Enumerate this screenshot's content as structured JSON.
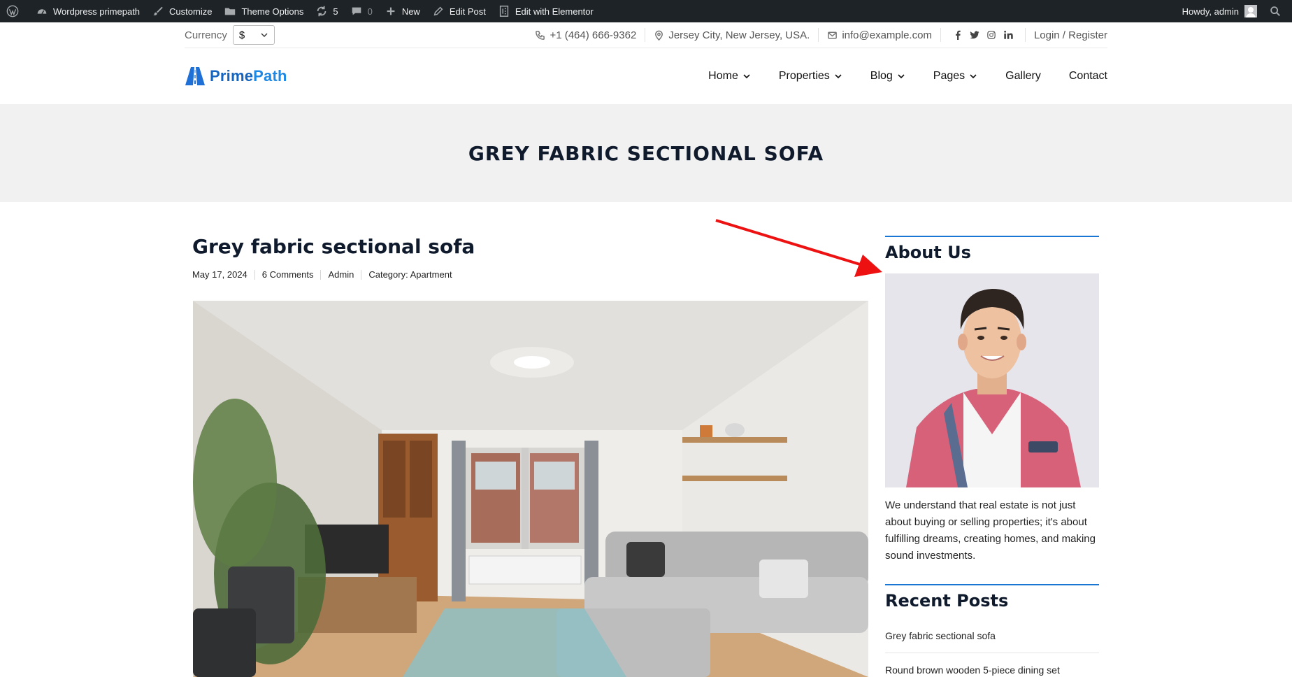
{
  "admin_bar": {
    "site_name": "Wordpress primepath",
    "customize": "Customize",
    "theme_options": "Theme Options",
    "updates_count": "5",
    "comments_count": "0",
    "new_label": "New",
    "edit_post": "Edit Post",
    "edit_elementor": "Edit with Elementor",
    "howdy": "Howdy, admin"
  },
  "topbar": {
    "currency_label": "Currency",
    "currency_value": "$",
    "phone": "+1 (464) 666-9362",
    "address": "Jersey City, New Jersey, USA.",
    "email": "info@example.com",
    "socials": [
      "facebook-icon",
      "twitter-icon",
      "instagram-icon",
      "linkedin-icon"
    ],
    "login": "Login / Register"
  },
  "header": {
    "logo_part1": "Prime",
    "logo_part2": "Path",
    "nav": [
      {
        "label": "Home",
        "dropdown": true
      },
      {
        "label": "Properties",
        "dropdown": true
      },
      {
        "label": "Blog",
        "dropdown": true
      },
      {
        "label": "Pages",
        "dropdown": true
      },
      {
        "label": "Gallery",
        "dropdown": false
      },
      {
        "label": "Contact",
        "dropdown": false
      }
    ]
  },
  "banner": {
    "title": "GREY FABRIC SECTIONAL SOFA"
  },
  "post": {
    "title": "Grey fabric sectional sofa",
    "meta": {
      "date": "May 17, 2024",
      "comments": "6 Comments",
      "author": "Admin",
      "category": "Category: Apartment"
    }
  },
  "sidebar": {
    "about_title": "About Us",
    "about_text": "We understand that real estate is not just about buying or selling properties; it's about fulfilling dreams, creating homes, and making sound investments.",
    "recent_title": "Recent Posts",
    "recent_posts": [
      "Grey fabric sectional sofa",
      "Round brown wooden 5-piece dining set"
    ]
  },
  "colors": {
    "admin_bar": "#1d2327",
    "accent": "#1976d2",
    "annotation_arrow": "#ee1111"
  }
}
